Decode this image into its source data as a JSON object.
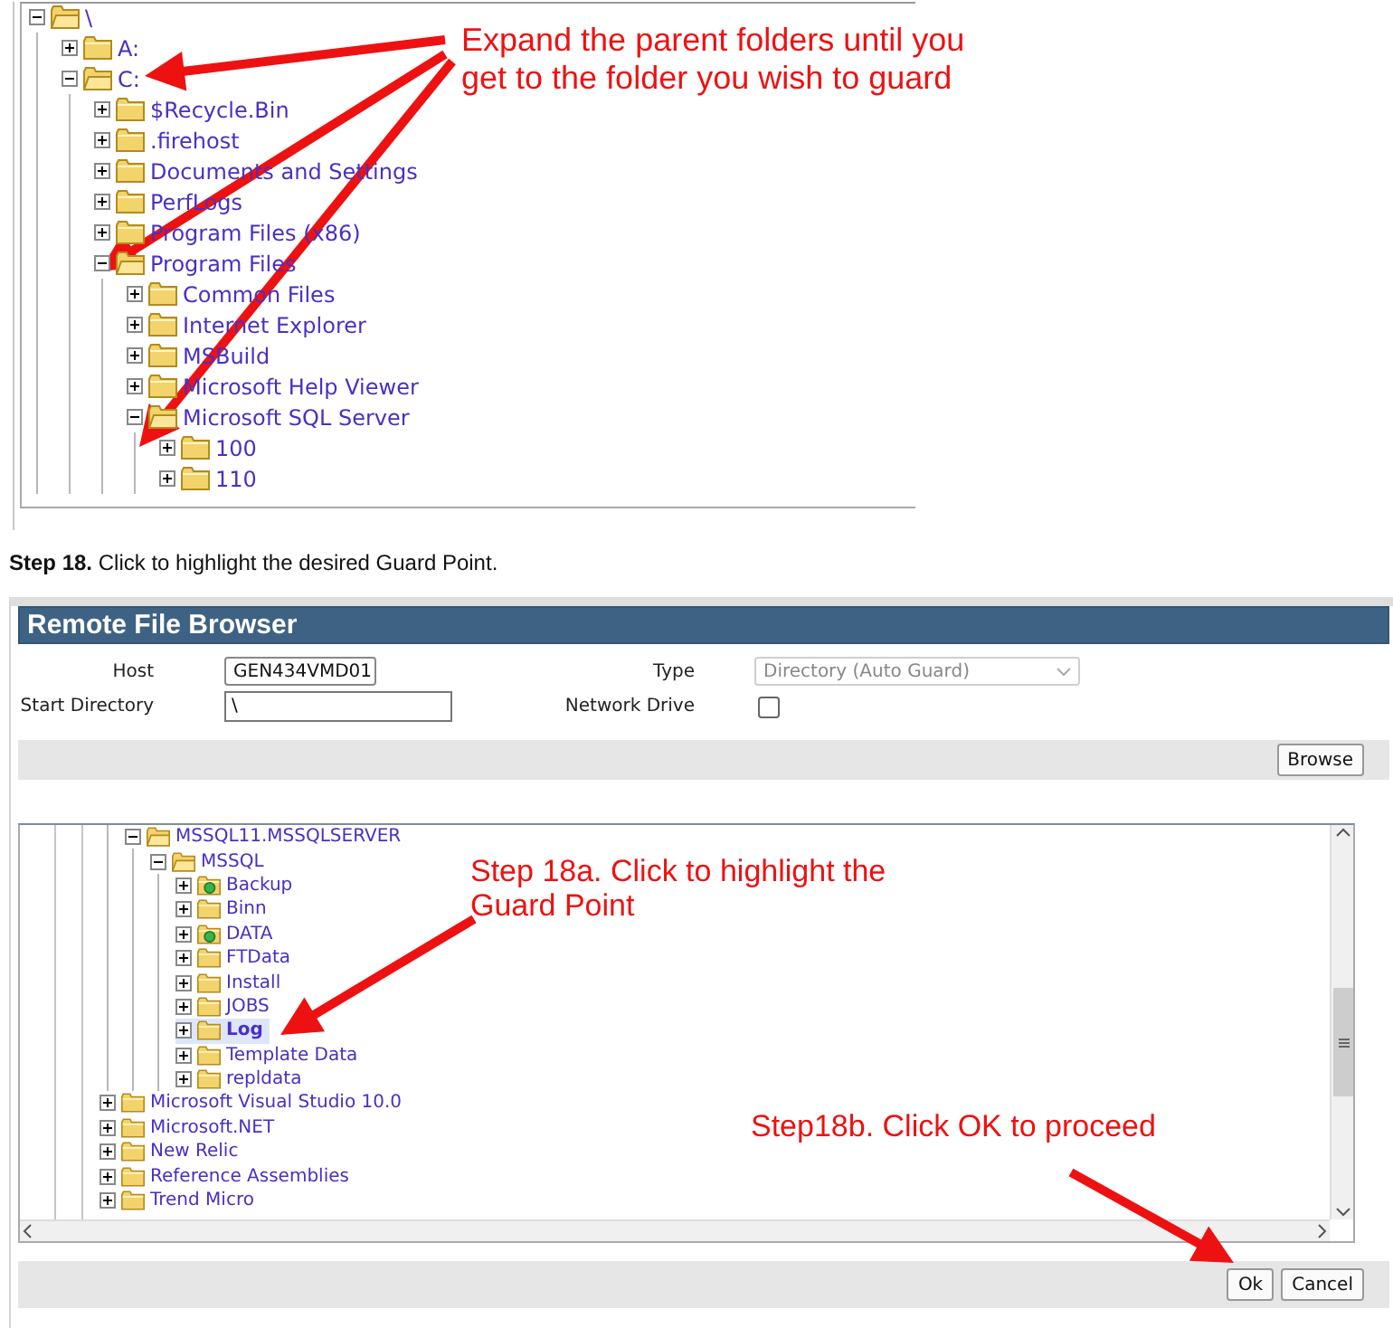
{
  "tutorial_tree": {
    "items": [
      {
        "label": "\\",
        "expanded": true,
        "children": [
          {
            "label": "A:",
            "expanded": false
          },
          {
            "label": "C:",
            "expanded": true,
            "children": [
              {
                "label": "$Recycle.Bin",
                "expanded": false
              },
              {
                "label": ".firehost",
                "expanded": false
              },
              {
                "label": "Documents and Settings",
                "expanded": false
              },
              {
                "label": "PerfLogs",
                "expanded": false
              },
              {
                "label": "Program Files (x86)",
                "expanded": false
              },
              {
                "label": "Program Files",
                "expanded": true,
                "children": [
                  {
                    "label": "Common Files",
                    "expanded": false
                  },
                  {
                    "label": "Internet Explorer",
                    "expanded": false
                  },
                  {
                    "label": "MSBuild",
                    "expanded": false
                  },
                  {
                    "label": "Microsoft Help Viewer",
                    "expanded": false
                  },
                  {
                    "label": "Microsoft SQL Server",
                    "expanded": true,
                    "children": [
                      {
                        "label": "100",
                        "expanded": false
                      },
                      {
                        "label": "110",
                        "expanded": false
                      }
                    ]
                  }
                ]
              }
            ]
          }
        ]
      }
    ]
  },
  "annotations": [
    "Expand the parent folders until you get to the folder you wish to guard",
    "Step 18a. Click to highlight the Guard Point",
    "Step18b. Click OK to proceed"
  ],
  "caption": "**Step 18.** Click to highlight the desired Guard Point.",
  "dialog": {
    "title": "Remote File Browser",
    "host": {
      "label": "Host",
      "value": "GEN434VMD01"
    },
    "type": {
      "label": "Type",
      "value": "Directory (Auto Guard)",
      "disabled": true
    },
    "start_directory": {
      "label": "Start Directory",
      "value": "\\"
    },
    "network_drive": {
      "label": "Network Drive",
      "checked": false
    },
    "browse_button": "Browse",
    "tree": {
      "items": [
        {
          "kind": "continuation",
          "label": "MSSQL11.MSSQLSERVER",
          "expanded": true,
          "selected": false,
          "guarded": false,
          "children": [
            {
              "label": "MSSQL",
              "expanded": true,
              "selected": false,
              "guarded": false,
              "children": [
                {
                  "label": "Backup",
                  "expanded": false,
                  "selected": false,
                  "guarded": true
                },
                {
                  "label": "Binn",
                  "expanded": false,
                  "selected": false,
                  "guarded": false
                },
                {
                  "label": "DATA",
                  "expanded": false,
                  "selected": false,
                  "guarded": true
                },
                {
                  "label": "FTData",
                  "expanded": false,
                  "selected": false,
                  "guarded": false
                },
                {
                  "label": "Install",
                  "expanded": false,
                  "selected": false,
                  "guarded": false
                },
                {
                  "label": "JOBS",
                  "expanded": false,
                  "selected": false,
                  "guarded": false
                },
                {
                  "label": "Log",
                  "expanded": false,
                  "selected": true,
                  "guarded": false
                },
                {
                  "label": "Template Data",
                  "expanded": false,
                  "selected": false,
                  "guarded": false
                },
                {
                  "label": "repldata",
                  "expanded": false,
                  "selected": false,
                  "guarded": false
                }
              ]
            }
          ]
        },
        {
          "kind": "folder",
          "label": "Microsoft Visual Studio 10.0",
          "expanded": false,
          "selected": false,
          "guarded": false
        },
        {
          "kind": "folder",
          "label": "Microsoft.NET",
          "expanded": false,
          "selected": false,
          "guarded": false
        },
        {
          "kind": "folder",
          "label": "New Relic",
          "expanded": false,
          "selected": false,
          "guarded": false
        },
        {
          "kind": "folder",
          "label": "Reference Assemblies",
          "expanded": false,
          "selected": false,
          "guarded": false
        },
        {
          "kind": "folder",
          "label": "Trend Micro",
          "expanded": false,
          "selected": false,
          "guarded": false
        }
      ]
    },
    "buttons": [
      "Ok",
      "Cancel"
    ]
  }
}
